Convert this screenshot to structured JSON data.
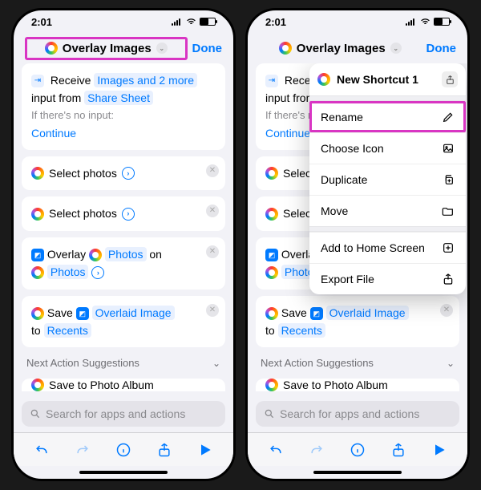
{
  "status": {
    "time": "2:01"
  },
  "header": {
    "title": "Overlay Images",
    "done": "Done"
  },
  "receive": {
    "word_receive": "Receive",
    "types": "Images and 2 more",
    "mid": "input from",
    "source": "Share Sheet",
    "noinput_label": "If there's no input:",
    "continue": "Continue"
  },
  "select_photos_label": "Select photos",
  "overlay": {
    "word": "Overlay",
    "photos": "Photos",
    "on": "on"
  },
  "save": {
    "word": "Save",
    "overlaid": "Overlaid Image",
    "to": "to",
    "recents": "Recents"
  },
  "suggestions_header": "Next Action Suggestions",
  "peek_label": "Save to Photo Album",
  "search_placeholder": "Search for apps and actions",
  "popover": {
    "name": "New Shortcut 1",
    "items": {
      "rename": "Rename",
      "choose_icon": "Choose Icon",
      "duplicate": "Duplicate",
      "move": "Move",
      "add_home": "Add to Home Screen",
      "export": "Export File"
    }
  }
}
